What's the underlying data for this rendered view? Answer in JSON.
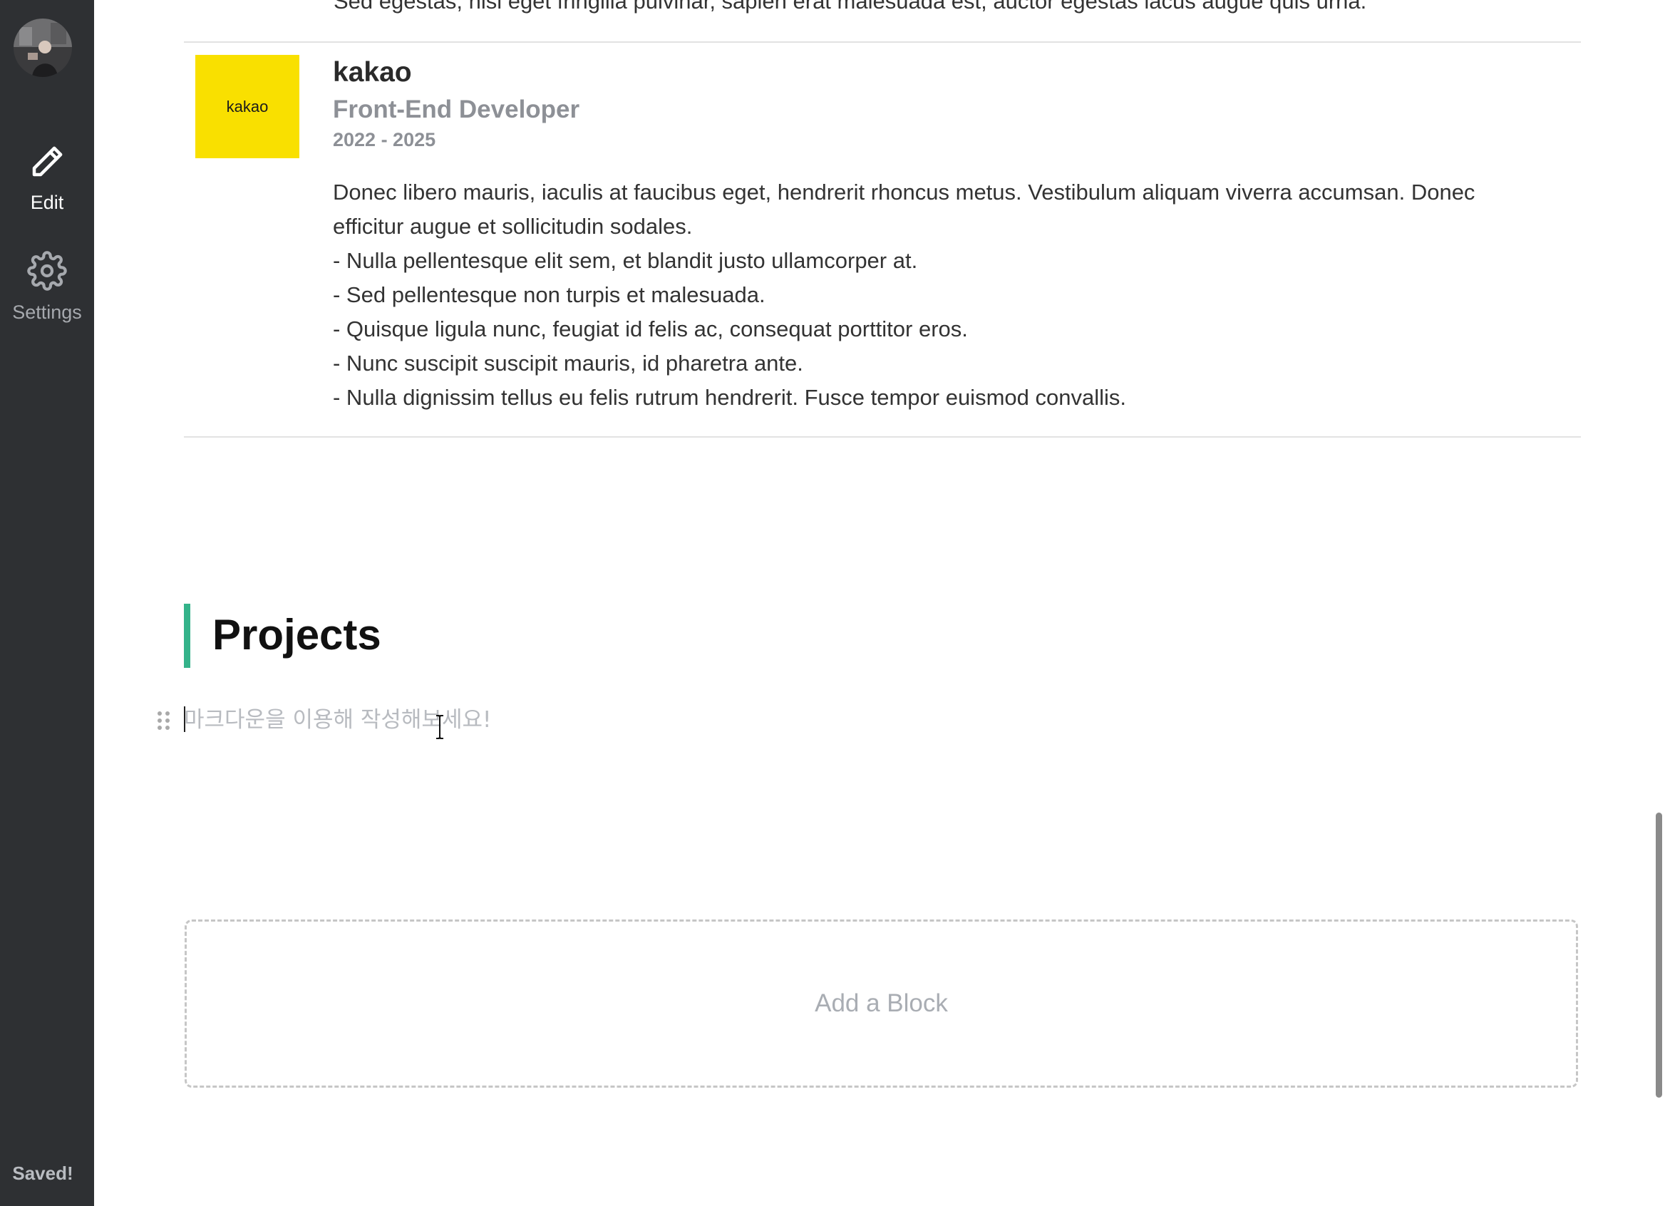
{
  "sidebar": {
    "edit_label": "Edit",
    "settings_label": "Settings",
    "status": "Saved!"
  },
  "previous_entry": {
    "last_line": "Sed egestas, nisi eget fringilla pulvinar, sapien erat malesuada est, auctor egestas lacus augue quis urna."
  },
  "experience": {
    "logo_text": "kakao",
    "logo_color": "#f9e000",
    "company": "kakao",
    "role": "Front-End Developer",
    "period": "2022 - 2025",
    "description": [
      "Donec libero mauris, iaculis at faucibus eget, hendrerit rhoncus metus. Vestibulum aliquam viverra accumsan. Donec",
      "efficitur augue et sollicitudin sodales.",
      "- Nulla pellentesque elit sem, et blandit justo ullamcorper at.",
      "- Sed pellentesque non turpis et malesuada.",
      "- Quisque ligula nunc, feugiat id felis ac, consequat porttitor eros.",
      "- Nunc suscipit suscipit mauris, id pharetra ante.",
      "- Nulla dignissim tellus eu felis rutrum hendrerit. Fusce tempor euismod convallis."
    ]
  },
  "projects": {
    "title": "Projects",
    "accent_color": "#34b38a",
    "editor_placeholder": "마크다운을 이용해 작성해보세요!",
    "editor_value": ""
  },
  "add_block_label": "Add a Block"
}
